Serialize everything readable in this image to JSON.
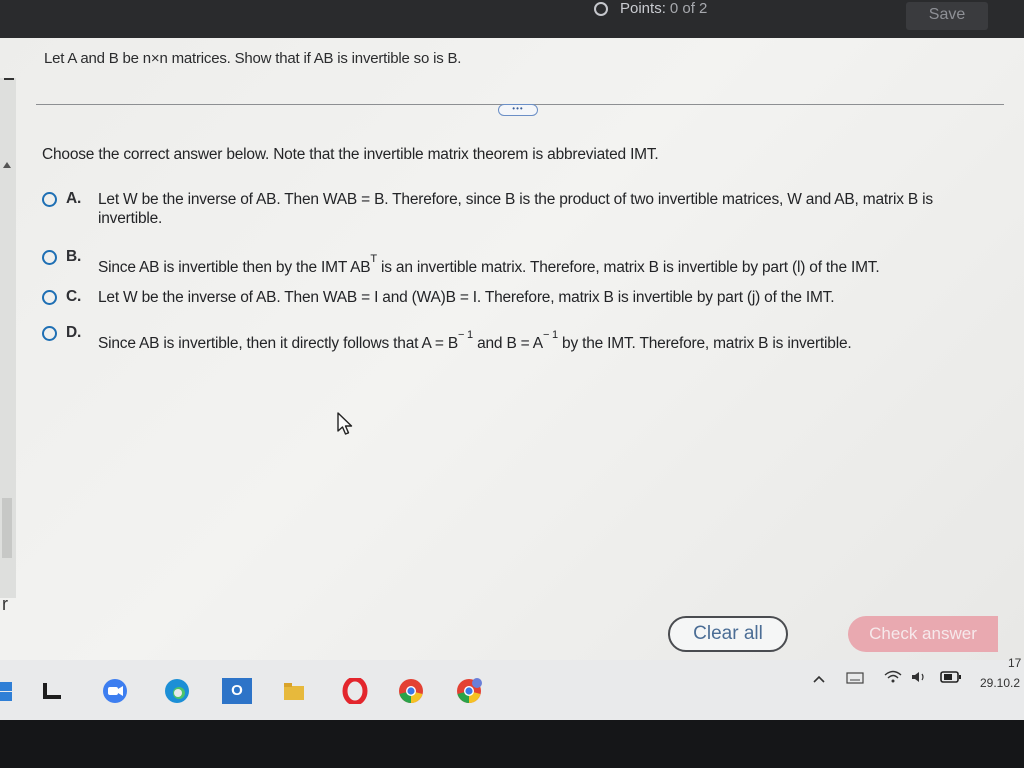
{
  "header": {
    "points_label": "Points:",
    "points_value": "0 of 2",
    "save_label": "Save"
  },
  "question": {
    "text": "Let A and B be n×n matrices. Show that if AB is invertible so is B.",
    "more_label": "•••"
  },
  "instruction": "Choose the correct answer below. Note that the invertible matrix theorem is abbreviated IMT.",
  "options": [
    {
      "letter": "A.",
      "text": "Let W be the inverse of AB. Then WAB = B. Therefore, since B is the product of two invertible matrices, W and AB, matrix B is invertible."
    },
    {
      "letter": "B.",
      "text_before": "Since AB is invertible then by the IMT AB",
      "sup": "T",
      "text_after": " is an invertible matrix. Therefore, matrix B is invertible by part (l) of the IMT."
    },
    {
      "letter": "C.",
      "text": "Let W be the inverse of AB. Then WAB = I and (WA)B = I. Therefore, matrix B is invertible by part (j) of the IMT."
    },
    {
      "letter": "D.",
      "text_1": "Since AB is invertible, then it directly follows that A = B",
      "sup_1": "− 1",
      "text_2": " and B = A",
      "sup_2": "− 1",
      "text_3": " by the IMT. Therefore, matrix B is invertible."
    }
  ],
  "actions": {
    "clear_all_label": "Clear all",
    "check_answer_label": "Check answer"
  },
  "edge_letter": "r",
  "taskbar": {
    "icons": [
      "widgets-icon",
      "file-explorer-icon",
      "zoom-icon",
      "edge-icon",
      "outlook-icon",
      "folder-icon",
      "opera-icon",
      "chrome-icon",
      "chrome-profile-icon"
    ],
    "outlook_label": "O",
    "tray_time": "17",
    "tray_date": "29.10.2"
  },
  "colors": {
    "accent_blue": "#1e6fb4",
    "check_answer_bg": "#e9a9b0",
    "panel_bg": "#efefed"
  }
}
